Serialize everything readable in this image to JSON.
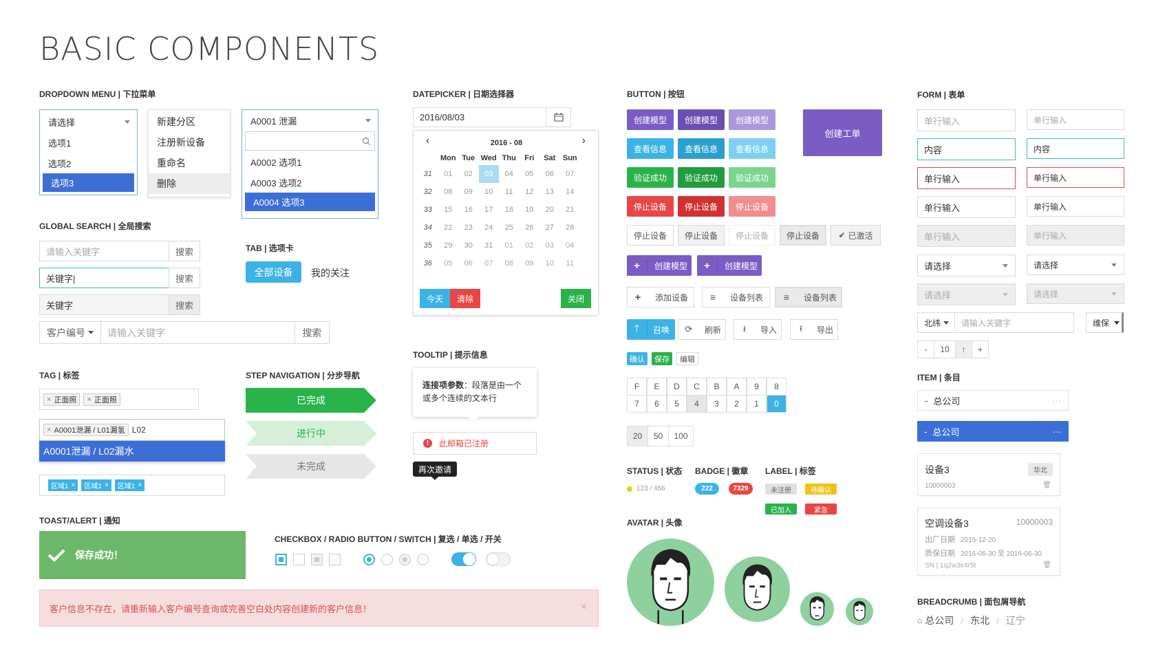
{
  "page_title": "BASIC COMPONENTS",
  "sections": {
    "dropdown": "DROPDOWN MENU | 下拉菜单",
    "datepicker": "DATEPICKER | 日期选择器",
    "button": "BUTTON | 按钮",
    "form": "FORM | 表单",
    "search": "GLOBAL SEARCH | 全局搜索",
    "tab": "TAB | 选项卡",
    "tag": "TAG | 标签",
    "step": "STEP NAVIGATION | 分步导航",
    "tooltip": "TOOLTIP | 提示信息",
    "toast": "TOAST/ALERT | 通知",
    "checkbox": "CHECKBOX / RADIO BUTTON / SWITCH | 复选 / 单选 / 开关",
    "status": "STATUS | 状态",
    "badge": "BADGE | 徽章",
    "label": "LABEL | 标签",
    "avatar": "AVATAR | 头像",
    "item": "ITEM | 条目",
    "breadcrumb": "BREADCRUMB | 面包屑导航"
  },
  "dropdown1": {
    "value": "请选择",
    "options": [
      "选项1",
      "选项2",
      "选项3"
    ],
    "selected_index": 2
  },
  "dropdown2": {
    "options": [
      "新建分区",
      "注册新设备",
      "重命名",
      "删除"
    ],
    "hover_index": 3
  },
  "dropdown3": {
    "value": "A0001 泄漏",
    "options": [
      "A0002 选项1",
      "A0003 选项2",
      "A0004 选项3"
    ],
    "selected_index": 2
  },
  "search": {
    "row1": {
      "placeholder": "请输入关键字",
      "button": "搜索"
    },
    "row2": {
      "value": "关键字|",
      "button": "搜索"
    },
    "row3": {
      "value": "关键字",
      "button": "搜索"
    },
    "row4": {
      "prefix": "客户编号",
      "placeholder": "请输入关键字",
      "button": "搜索"
    }
  },
  "tabs": {
    "active": "全部设备",
    "other": "我的关注"
  },
  "tags": {
    "row1": [
      "正面照",
      "正面照"
    ],
    "row2": {
      "tag": "A0001泄漏 / L01漏氢",
      "typed": "L02"
    },
    "suggestion": "A0001泄漏 / L02漏水",
    "row3": [
      "区域1",
      "区域1",
      "区域1"
    ]
  },
  "steps": [
    "已完成",
    "进行中",
    "未完成"
  ],
  "datepicker": {
    "value": "2016/08/03",
    "month_label": "2016 - 08",
    "weekdays": [
      "Mon",
      "Tue",
      "Wed",
      "Thu",
      "Fri",
      "Sat",
      "Sun"
    ],
    "weeks": [
      {
        "wk": "31",
        "days": [
          "01",
          "02",
          "03",
          "04",
          "05",
          "06",
          "07"
        ]
      },
      {
        "wk": "32",
        "days": [
          "08",
          "09",
          "10",
          "11",
          "12",
          "13",
          "14"
        ]
      },
      {
        "wk": "33",
        "days": [
          "15",
          "16",
          "17",
          "18",
          "19",
          "20",
          "21"
        ]
      },
      {
        "wk": "34",
        "days": [
          "22",
          "23",
          "24",
          "25",
          "26",
          "27",
          "28"
        ]
      },
      {
        "wk": "35",
        "days": [
          "29",
          "30",
          "31",
          "01",
          "02",
          "03",
          "04"
        ]
      },
      {
        "wk": "36",
        "days": [
          "05",
          "06",
          "07",
          "08",
          "09",
          "10",
          "11"
        ]
      }
    ],
    "selected_day": "03",
    "today": "今天",
    "clear": "清除",
    "close": "关闭"
  },
  "tooltip": {
    "bold": "连接项参数",
    "text1": "：段落是由一个",
    "text2": "或多个连续的文本行",
    "error": "此邮箱已注册",
    "dark": "再次邀请"
  },
  "toast": {
    "success": "保存成功！",
    "alert": "客户信息不存在，请重新输入客户编号查询或完善空白处内容创建新的客户信息！"
  },
  "buttons": {
    "create_model": "创建模型",
    "view_info": "查看信息",
    "verify_ok": "验证成功",
    "stop_device": "停止设备",
    "activated": "已激活",
    "create_order": "创建工单",
    "add_device": "添加设备",
    "device_list": "设备列表",
    "summon": "召唤",
    "refresh": "刷新",
    "import": "导入",
    "export": "导出",
    "confirm": "确认",
    "save": "保存",
    "edit": "编辑"
  },
  "keypad": {
    "row1": [
      "F",
      "E",
      "D",
      "C",
      "B",
      "A",
      "9",
      "8"
    ],
    "row2": [
      "7",
      "6",
      "5",
      "4",
      "3",
      "2",
      "1",
      "0"
    ]
  },
  "page_size": [
    "20",
    "50",
    "100"
  ],
  "status": {
    "text": "123 / 456",
    "color": "#f5c518"
  },
  "badges": [
    {
      "text": "222",
      "color": "#3bb3e4"
    },
    {
      "text": "7329",
      "color": "#e84545"
    }
  ],
  "labels": [
    {
      "text": "未注册",
      "color": "#bbbbbb"
    },
    {
      "text": "待确认",
      "color": "#f2c21b"
    },
    {
      "text": "已加入",
      "color": "#29b34a"
    },
    {
      "text": "紧急",
      "color": "#e84545"
    }
  ],
  "form": {
    "placeholder": "单行输入",
    "content": "内容",
    "single": "单行输入",
    "select": "请选择",
    "prefix": "北纬",
    "kw_placeholder": "请输入关键字",
    "stepper_value": "10",
    "repair": "维保"
  },
  "items": {
    "item1": "总公司",
    "item2": "总公司",
    "card1": {
      "title": "设备3",
      "region": "华北",
      "code": "10000003"
    },
    "card2": {
      "title": "空调设备3",
      "code": "10000003",
      "prod_label": "出厂日期",
      "prod": "2015-12-20",
      "warranty_label": "质保日期",
      "warranty": "2016-06-30 至 2016-06-30",
      "sn": "SN | 1q2w3e4r5t"
    }
  },
  "breadcrumb": [
    "总公司",
    "东北",
    "辽宁"
  ],
  "colors": {
    "purple": "#7a5cc4",
    "blue": "#3bb3e4",
    "green": "#29b34a",
    "red": "#e84545",
    "primary": "#3c6fd6"
  }
}
